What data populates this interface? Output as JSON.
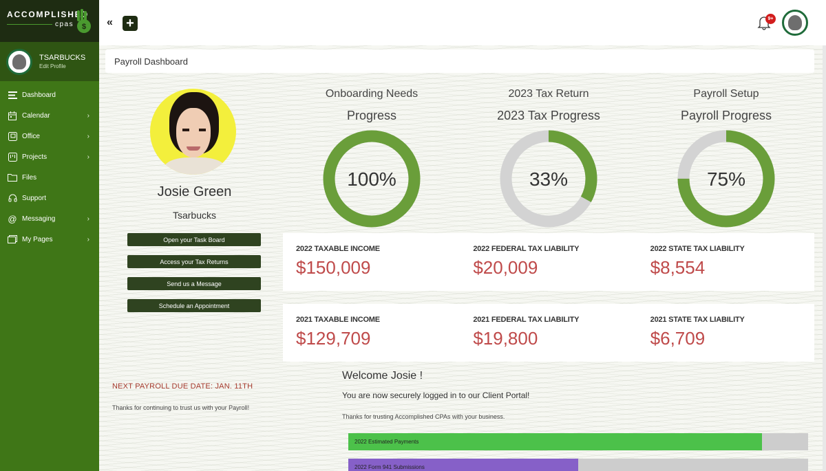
{
  "brand": {
    "line1": "ACCOMPLISHED",
    "line2": "cpas"
  },
  "user": {
    "account_name": "TSARBUCKS",
    "edit_profile": "Edit Profile"
  },
  "sidebar": {
    "items": [
      {
        "label": "Dashboard",
        "icon": "menu-icon",
        "has_submenu": false
      },
      {
        "label": "Calendar",
        "icon": "calendar-icon",
        "has_submenu": true
      },
      {
        "label": "Office",
        "icon": "office-icon",
        "has_submenu": true
      },
      {
        "label": "Projects",
        "icon": "projects-icon",
        "has_submenu": true
      },
      {
        "label": "Files",
        "icon": "folder-icon",
        "has_submenu": false
      },
      {
        "label": "Support",
        "icon": "headset-icon",
        "has_submenu": false
      },
      {
        "label": "Messaging",
        "icon": "at-icon",
        "has_submenu": true
      },
      {
        "label": "My Pages",
        "icon": "pages-icon",
        "has_submenu": true
      }
    ],
    "chevron": "›"
  },
  "topbar": {
    "collapse": "«",
    "add": "+",
    "notification_badge": "9+"
  },
  "page_title": "Payroll Dashboard",
  "client": {
    "name": "Josie Green",
    "company": "Tsarbucks",
    "actions": [
      "Open your Task Board",
      "Access your Tax Returns",
      "Send us a Message",
      "Schedule an Appointment"
    ]
  },
  "gauges": [
    {
      "title": "Onboarding Needs",
      "subtitle": "Progress",
      "percent": 100,
      "label": "100%"
    },
    {
      "title": "2023 Tax Return",
      "subtitle": "2023 Tax Progress",
      "percent": 33,
      "label": "33%"
    },
    {
      "title": "Payroll Setup",
      "subtitle": "Payroll Progress",
      "percent": 75,
      "label": "75%"
    }
  ],
  "colors": {
    "accent_green": "#6a9e3a",
    "track_gray": "#d3d3d3",
    "money_red": "#bf4a4a",
    "due_red": "#a63b2e"
  },
  "tax_2022": [
    {
      "label": "2022 TAXABLE INCOME",
      "value": "$150,009"
    },
    {
      "label": "2022 FEDERAL TAX LIABILITY",
      "value": "$20,009"
    },
    {
      "label": "2022 STATE TAX LIABILITY",
      "value": "$8,554"
    }
  ],
  "tax_2021": [
    {
      "label": "2021 TAXABLE INCOME",
      "value": "$129,709"
    },
    {
      "label": "2021 FEDERAL TAX LIABILITY",
      "value": "$19,800"
    },
    {
      "label": "2021 STATE TAX LIABILITY",
      "value": "$6,709"
    }
  ],
  "payroll_notice": {
    "due_date": "NEXT PAYROLL DUE DATE: JAN. 11TH",
    "thanks": "Thanks for continuing to trust us with your Payroll!"
  },
  "welcome": {
    "heading": "Welcome Josie !",
    "secure": "You are now securely logged in to our Client Portal!",
    "thanks": "Thanks for trusting Accomplished CPAs with your business."
  },
  "progress_bars": [
    {
      "label": "2022 Estimated Payments",
      "percent": 90,
      "color": "#4cc14a"
    },
    {
      "label": "2022 Form 941 Submissions",
      "percent": 50,
      "color": "#8660c8"
    }
  ]
}
